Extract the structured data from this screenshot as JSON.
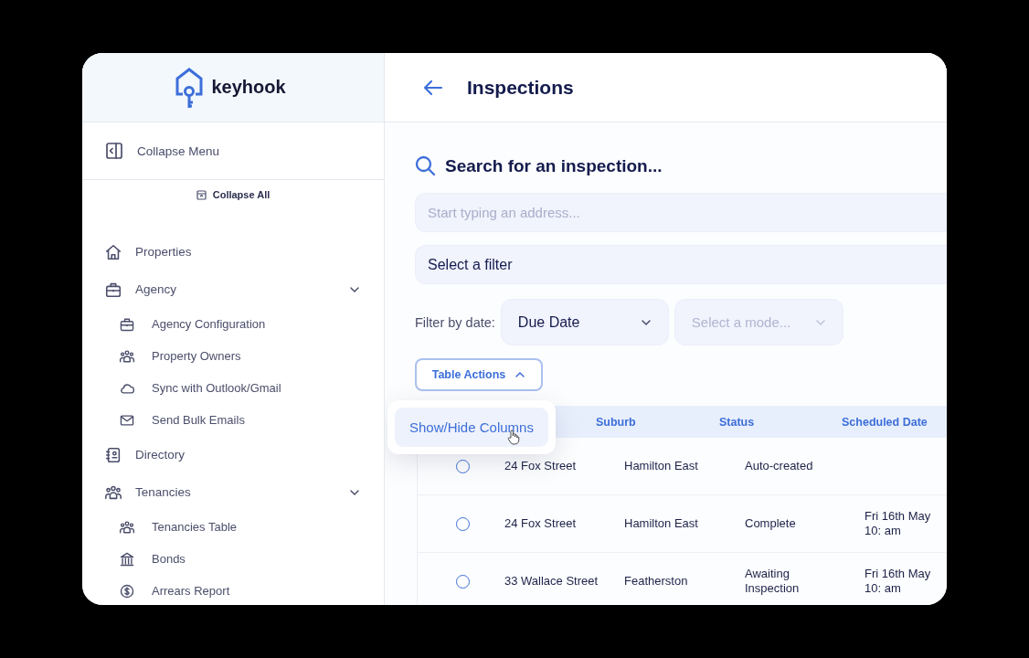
{
  "sidebar": {
    "logo": "keyhook",
    "collapse_menu": "Collapse Menu",
    "collapse_all": "Collapse All",
    "items": [
      {
        "label": "Properties"
      },
      {
        "label": "Agency",
        "expanded": true,
        "children": [
          {
            "label": "Agency Configuration"
          },
          {
            "label": "Property Owners"
          },
          {
            "label": "Sync with Outlook/Gmail"
          },
          {
            "label": "Send Bulk Emails"
          }
        ]
      },
      {
        "label": "Directory"
      },
      {
        "label": "Tenancies",
        "expanded": true,
        "children": [
          {
            "label": "Tenancies Table"
          },
          {
            "label": "Bonds"
          },
          {
            "label": "Arrears Report"
          }
        ]
      }
    ]
  },
  "main": {
    "title": "Inspections",
    "search_heading": "Search for an inspection...",
    "address_field": {
      "placeholder": "Start typing an address..."
    },
    "filter_select": {
      "value": "Select a filter"
    },
    "date_filter_label": "Filter by date:",
    "date_field": {
      "value": "Due Date"
    },
    "mode_field": {
      "placeholder": "Select a mode..."
    },
    "table_actions": {
      "label": "Table Actions",
      "expanded": true
    },
    "table_actions_menu": [
      {
        "label": "Show/Hide Columns"
      }
    ],
    "table": {
      "columns": [
        "Suburb",
        "Status",
        "Scheduled Date"
      ],
      "rows": [
        {
          "selected": false,
          "address": "24 Fox Street",
          "suburb": "Hamilton East",
          "status": "Auto-created"
        },
        {
          "selected": false,
          "address": "24 Fox Street",
          "suburb": "Hamilton East",
          "status": "Complete",
          "scheduled": "Fri 16th May 10: am"
        },
        {
          "selected": false,
          "address": "33 Wallace Street",
          "suburb": "Featherston",
          "status": "Awaiting Inspection",
          "scheduled": "Fri 16th May 10: am"
        }
      ]
    }
  }
}
